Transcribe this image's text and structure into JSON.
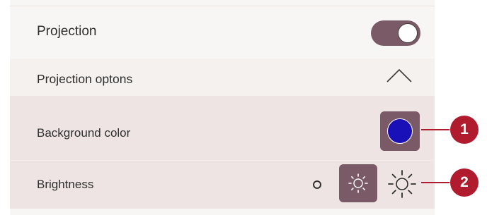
{
  "settings": {
    "projection": {
      "label": "Projection",
      "enabled": true
    },
    "projection_options": {
      "label": "Projection optons",
      "expanded": true
    },
    "background_color": {
      "label": "Background color",
      "value_color": "#1a10b8"
    },
    "brightness": {
      "label": "Brightness",
      "selected_level": "medium",
      "levels": [
        "low",
        "medium",
        "high"
      ]
    }
  },
  "callouts": [
    {
      "number": "1"
    },
    {
      "number": "2"
    }
  ],
  "colors": {
    "accent": "#7b5a67",
    "callout": "#b01c2e",
    "expanded_bg": "#ede4e3"
  },
  "icons": {
    "collapse": "chevron-up-icon",
    "brightness_low": "dot-icon",
    "brightness_mid": "sun-icon",
    "brightness_high": "sun-icon"
  }
}
